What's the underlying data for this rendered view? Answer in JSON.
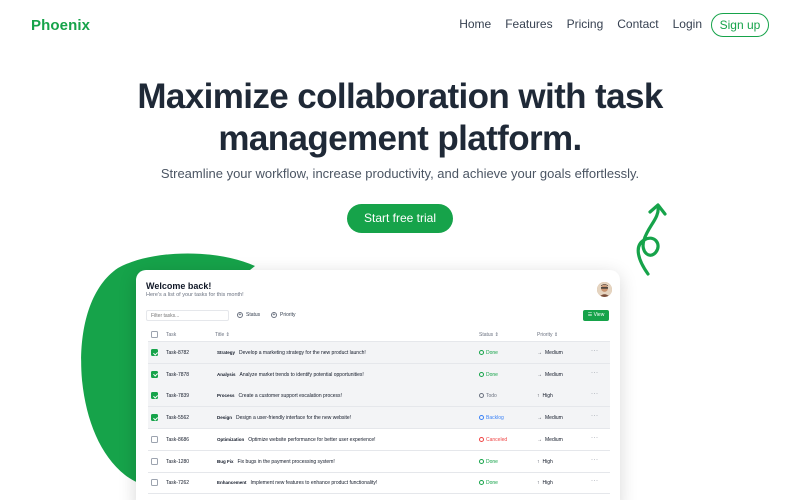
{
  "nav": {
    "logo": "Phoenix",
    "links": [
      "Home",
      "Features",
      "Pricing",
      "Contact",
      "Login"
    ],
    "signup": "Sign up"
  },
  "hero": {
    "title_line1": "Maximize collaboration with task",
    "title_line2": "management platform.",
    "subtitle": "Streamline your workflow, increase productivity, and achieve your goals effortlessly.",
    "cta": "Start free trial"
  },
  "colors": {
    "accent": "#16a34a",
    "heading": "#1f2937"
  },
  "app": {
    "welcome": "Welcome back!",
    "subtitle": "Here's a list of your tasks for this month!",
    "filter_placeholder": "Filter tasks...",
    "status_filter": "Status",
    "priority_filter": "Priority",
    "view_button": "View",
    "columns": {
      "task": "Task",
      "title": "Title",
      "status": "Status",
      "priority": "Priority"
    },
    "rows": [
      {
        "id": "Task-8782",
        "label": "Strategy",
        "title": "Develop a marketing strategy for the new product launch!",
        "status": "Done",
        "priority": "Medium",
        "checked": true
      },
      {
        "id": "Task-7878",
        "label": "Analysis",
        "title": "Analyze market trends to identify potential opportunities!",
        "status": "Done",
        "priority": "Medium",
        "checked": true
      },
      {
        "id": "Task-7839",
        "label": "Process",
        "title": "Create a customer support escalation process!",
        "status": "Todo",
        "priority": "High",
        "checked": true
      },
      {
        "id": "Task-5562",
        "label": "Design",
        "title": "Design a user-friendly interface for the new website!",
        "status": "Backlog",
        "priority": "Medium",
        "checked": true
      },
      {
        "id": "Task-8686",
        "label": "Optimization",
        "title": "Optimize website performance for better user experience!",
        "status": "Canceled",
        "priority": "Medium",
        "checked": false
      },
      {
        "id": "Task-1280",
        "label": "Bug Fix",
        "title": "Fix bugs in the payment processing system!",
        "status": "Done",
        "priority": "High",
        "checked": false
      },
      {
        "id": "Task-7262",
        "label": "Enhancement",
        "title": "Implement new features to enhance product functionality!",
        "status": "Done",
        "priority": "High",
        "checked": false
      }
    ]
  }
}
